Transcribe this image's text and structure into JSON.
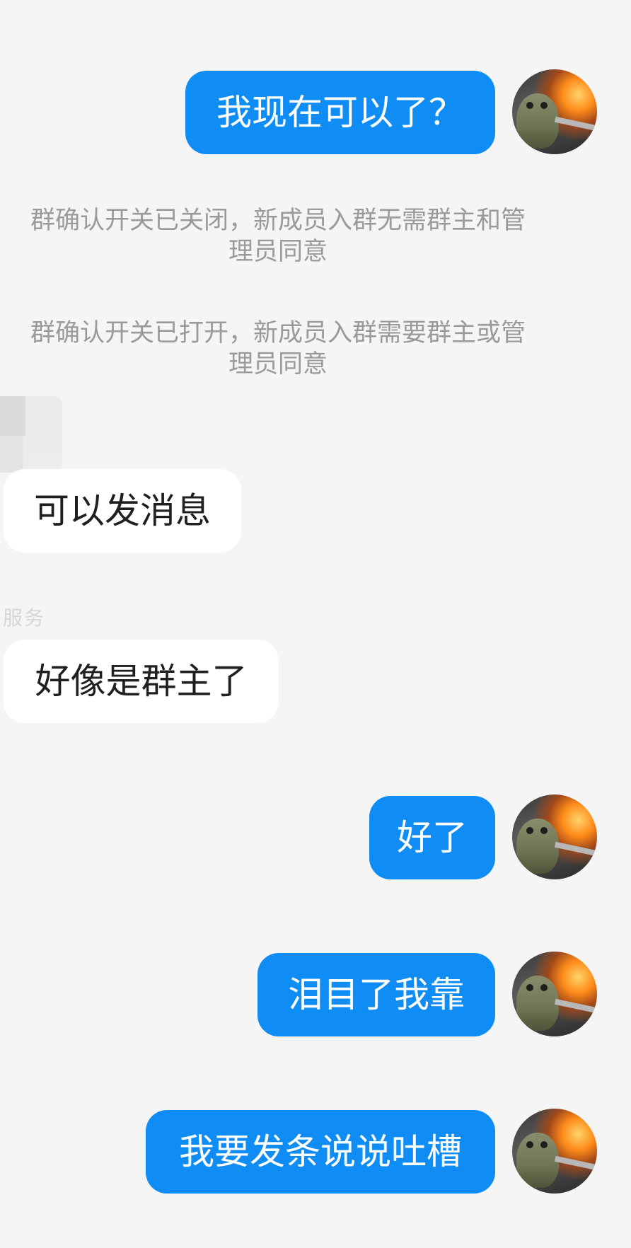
{
  "messages": {
    "m1_outgoing": "我现在可以了？",
    "sys1_line1": "群确认开关已关闭，新成员入群无需群主和管",
    "sys1_line2": "理员同意",
    "sys2_line1": "群确认开关已打开，新成员入群需要群主或管",
    "sys2_line2": "理员同意",
    "m2_incoming": "可以发消息",
    "sender_name": "服务",
    "m3_incoming": "好像是群主了",
    "m4_outgoing": "好了",
    "m5_outgoing": "泪目了我靠",
    "m6_outgoing": "我要发条说说吐槽"
  },
  "colors": {
    "background": "#f5f5f5",
    "outgoing_bubble": "#0f8df5",
    "incoming_bubble": "#ffffff",
    "system_text": "#9a9a9a"
  },
  "icons": {
    "my_avatar": "frog-train-avatar",
    "other_avatar": "blurred-avatar"
  }
}
